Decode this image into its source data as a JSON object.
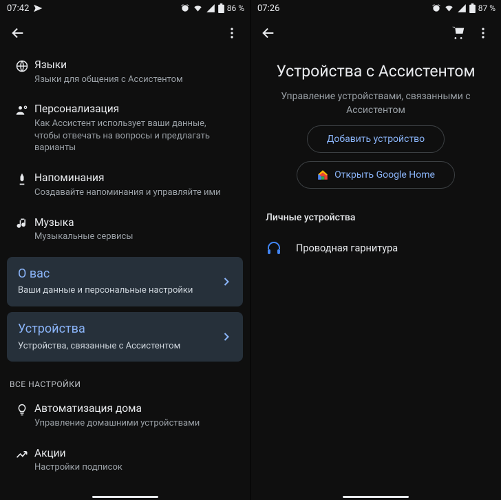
{
  "left": {
    "status": {
      "time": "07:42",
      "battery": "86 %"
    },
    "items": {
      "languages": {
        "title": "Языки",
        "sub": "Языки для общения с Ассистентом"
      },
      "personalization": {
        "title": "Персонализация",
        "sub": "Как Ассистент использует ваши данные, чтобы отвечать на вопросы и предлагать варианты"
      },
      "reminders": {
        "title": "Напоминания",
        "sub": "Создавайте напоминания и управляйте ими"
      },
      "music": {
        "title": "Музыка",
        "sub": "Музыкальные сервисы"
      },
      "about_you": {
        "title": "О вас",
        "sub": "Ваши данные и персональные настройки"
      },
      "devices": {
        "title": "Устройства",
        "sub": "Устройства, связанные с Ассистентом"
      },
      "home_auto": {
        "title": "Автоматизация дома",
        "sub": "Управление домашними устройствами"
      },
      "stocks": {
        "title": "Акции",
        "sub": "Настройки подписок"
      }
    },
    "all_settings_label": "ВСЕ НАСТРОЙКИ"
  },
  "right": {
    "status": {
      "time": "07:26",
      "battery": "87 %"
    },
    "title": "Устройства с Ассистентом",
    "subtitle": "Управление устройствами, связанными с Ассистентом",
    "add_device_label": "Добавить устройство",
    "open_home_label": "Открыть Google Home",
    "personal_devices_label": "Личные устройства",
    "device1_label": "Проводная гарнитура"
  }
}
